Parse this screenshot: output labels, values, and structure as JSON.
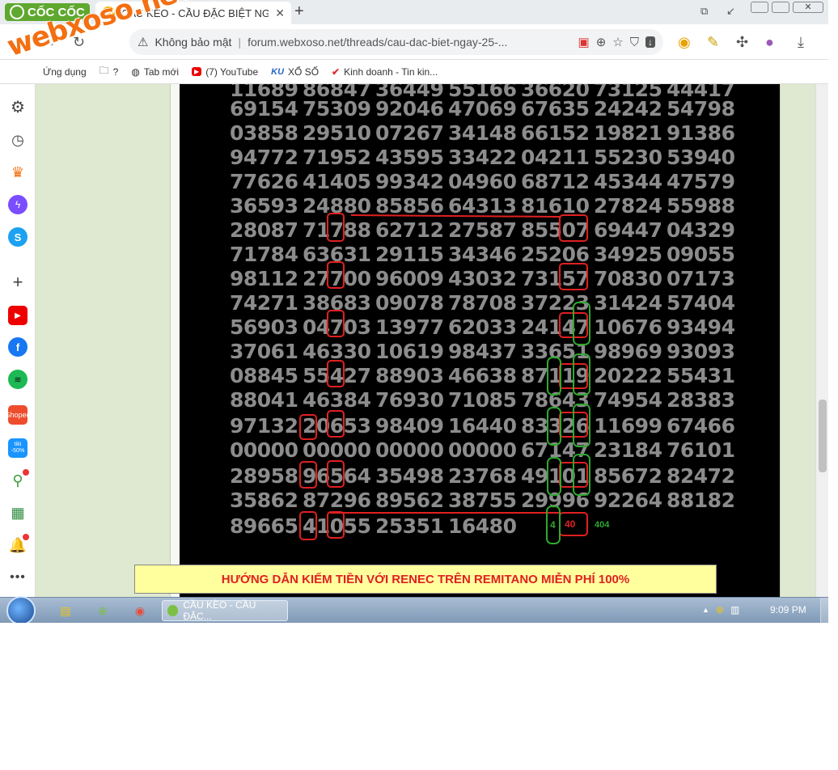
{
  "browser": {
    "brand": "CỐC CỐC",
    "tab": {
      "favicon": "XS",
      "title": "CẦU KÈO - CẦU ĐẶC BIỆT NG",
      "close": "✕"
    },
    "new_tab": "+",
    "address": {
      "security_label": "Không bảo mật",
      "url": "forum.webxoso.net/threads/cau-dac-biet-ngay-25-..."
    },
    "bookmarks": [
      {
        "label": "Ứng dụng",
        "icon": "apps-icon"
      },
      {
        "label": "?",
        "icon": "folder-icon"
      },
      {
        "label": "Tab mới",
        "icon": "globe-icon"
      },
      {
        "label": "(7) YouTube",
        "icon": "youtube-icon"
      },
      {
        "label": "XỔ SỐ",
        "icon": "ku-icon"
      },
      {
        "label": "Kinh doanh - Tin kin...",
        "icon": "tick-icon"
      }
    ]
  },
  "watermark": "webxoso.net",
  "sidebar_icons": [
    "gear-icon",
    "history-icon",
    "crown-icon",
    "messenger-icon",
    "skype-icon",
    "plus-icon",
    "youtube-icon",
    "facebook-icon",
    "spotify-icon",
    "shopee-icon",
    "tiki-icon",
    "green-app-icon",
    "sheets-icon",
    "bell-icon",
    "more-icon"
  ],
  "sidebar_labels": {
    "shopee": "Shopee",
    "tiki_top": "tiki",
    "tiki_bottom": "-50%",
    "skype": "S",
    "facebook": "f"
  },
  "board": {
    "rows": [
      [
        "11689",
        "86847",
        "36449",
        "55166",
        "36620",
        "73125",
        "44417"
      ],
      [
        "69154",
        "75309",
        "92046",
        "47069",
        "67635",
        "24242",
        "54798"
      ],
      [
        "03858",
        "29510",
        "07267",
        "34148",
        "66152",
        "19821",
        "91386"
      ],
      [
        "94772",
        "71952",
        "43595",
        "33422",
        "04211",
        "55230",
        "53940"
      ],
      [
        "77626",
        "41405",
        "99342",
        "04960",
        "68712",
        "45344",
        "47579"
      ],
      [
        "36593",
        "24880",
        "85856",
        "64313",
        "81610",
        "27824",
        "55988"
      ],
      [
        "28087",
        "71788",
        "62712",
        "27587",
        "85507",
        "69447",
        "04329"
      ],
      [
        "71784",
        "63631",
        "29115",
        "34346",
        "25206",
        "34925",
        "09055"
      ],
      [
        "98112",
        "27700",
        "96009",
        "43032",
        "73157",
        "70830",
        "07173"
      ],
      [
        "74271",
        "38683",
        "09078",
        "78708",
        "37223",
        "31424",
        "57404"
      ],
      [
        "56903",
        "04703",
        "13977",
        "62033",
        "24147",
        "10676",
        "93494"
      ],
      [
        "37061",
        "46330",
        "10619",
        "98437",
        "33651",
        "98969",
        "93093"
      ],
      [
        "08845",
        "55427",
        "88903",
        "46638",
        "87119",
        "20222",
        "55431"
      ],
      [
        "88041",
        "46384",
        "76930",
        "71085",
        "78643",
        "74954",
        "28383"
      ],
      [
        "97132",
        "20653",
        "98409",
        "16440",
        "83326",
        "11699",
        "67466"
      ],
      [
        "00000",
        "00000",
        "00000",
        "00000",
        "67147",
        "23184",
        "76101"
      ],
      [
        "28958",
        "96564",
        "35498",
        "23768",
        "49101",
        "85672",
        "82472"
      ],
      [
        "35862",
        "87296",
        "89562",
        "38755",
        "29996",
        "92264",
        "88182"
      ],
      [
        "89665",
        "41055",
        "25351",
        "16480",
        "",
        "",
        ""
      ]
    ],
    "annotations": {
      "green_4": "4",
      "red_40": "40",
      "green_404": "404"
    }
  },
  "banner": "HƯỚNG DẪN KIẾM TIỀN VỚI RENEC TRÊN REMITANO MIỄN PHÍ 100%",
  "taskbar": {
    "task_label": "CẦU KÈO - CẦU ĐẶC...",
    "clock": "9:09 PM",
    "tray_up": "▲"
  },
  "colors": {
    "board_bg": "#000000",
    "digits": "#8c8c8c",
    "red_mark": "#e02020",
    "green_mark": "#2fa82f",
    "banner_bg": "#ffff9e"
  }
}
